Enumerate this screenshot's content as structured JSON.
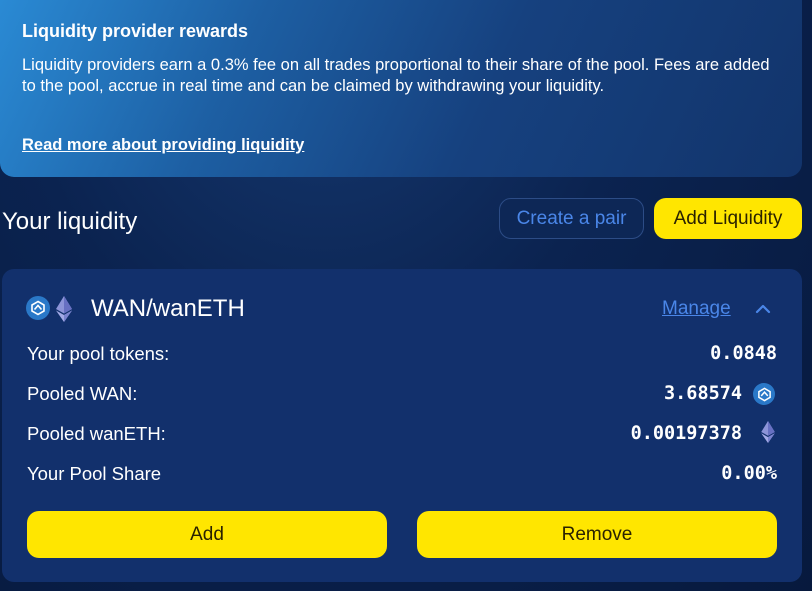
{
  "info": {
    "title": "Liquidity provider rewards",
    "body": "Liquidity providers earn a 0.3% fee on all trades proportional to their share of the pool. Fees are added to the pool, accrue in real time and can be claimed by withdrawing your liquidity.",
    "link": "Read more about providing liquidity"
  },
  "section": {
    "title": "Your liquidity",
    "create_pair_label": "Create a pair",
    "add_liquidity_label": "Add Liquidity"
  },
  "pool": {
    "pair": "WAN/wanETH",
    "manage_label": "Manage",
    "rows": [
      {
        "label": "Your pool tokens:",
        "value": "0.0848"
      },
      {
        "label": "Pooled WAN:",
        "value": "3.68574"
      },
      {
        "label": "Pooled wanETH:",
        "value": "0.00197378"
      },
      {
        "label": "Your Pool Share",
        "value": "0.00%"
      }
    ],
    "add_label": "Add",
    "remove_label": "Remove"
  },
  "colors": {
    "accent_yellow": "#ffe600",
    "link_blue": "#4a86e8",
    "card_bg": "#12306c"
  },
  "icons": [
    "wan-token-icon",
    "eth-token-icon",
    "chevron-up-icon"
  ]
}
